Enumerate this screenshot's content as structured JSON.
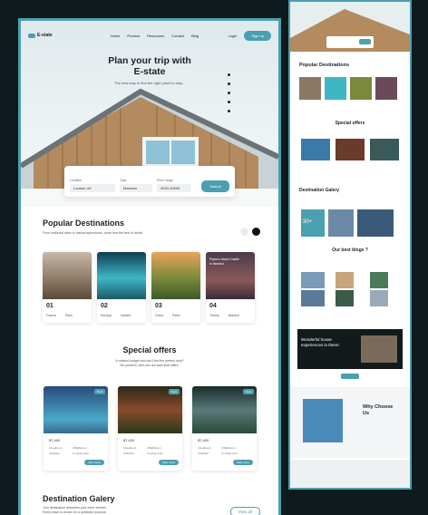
{
  "nav": {
    "logo": "E-state",
    "links": [
      "Home",
      "Product",
      "Resources",
      "Contact",
      "Blog"
    ],
    "login": "Login",
    "signup": "Sign up"
  },
  "hero": {
    "title_line1": "Plan your trip with",
    "title_line2": "E-state",
    "subtitle": "The best way to find the right place to stay..."
  },
  "search": {
    "fields": [
      {
        "label": "Location",
        "value": "London UK"
      },
      {
        "label": "Type",
        "value": "Mansion"
      },
      {
        "label": "Price range",
        "value": "3000-40005"
      }
    ],
    "button": "Search"
  },
  "popular": {
    "title": "Popular Destinations",
    "subtitle": "From historical cities to natural splendours, come see the best of world!",
    "cards": [
      {
        "num": "01",
        "a": "France",
        "b": "Paris"
      },
      {
        "num": "02",
        "a": "Norway",
        "b": "Iceland"
      },
      {
        "num": "03",
        "a": "China",
        "b": "Pekin"
      },
      {
        "num": "04",
        "a": "Turkey",
        "b": "Istanbul",
        "overlay": "Payson Island Castle in Istanbul"
      }
    ]
  },
  "offers": {
    "title": "Special offers",
    "subtitle_line1": "A relaxed budget and can't find the perfect deal?",
    "subtitle_line2": "No problem, here are our best deal offers.",
    "cards": [
      {
        "price": "$7,400",
        "badge": "New",
        "features": [
          "4 bedroom",
          "4 Bathroom",
          "4 kitchen",
          "1 Living room"
        ],
        "button": "View more"
      },
      {
        "price": "$7,400",
        "badge": "New",
        "features": [
          "4 bedroom",
          "4 Bathroom",
          "4 kitchen",
          "1 Living room"
        ],
        "button": "View more"
      },
      {
        "price": "$7,400",
        "badge": "New",
        "features": [
          "4 bedroom",
          "4 Bathroom",
          "4 kitchen",
          "1 Living room"
        ],
        "button": "View more"
      }
    ]
  },
  "gallery": {
    "title": "Destination Galery",
    "sub_line1": "Your destination describes your inner desires.",
    "sub_line2": "Every place is known for a particular purpose.",
    "view_all": "View all"
  },
  "right": {
    "popular": "Popular Destinations",
    "offers": "Special offers",
    "gallery": "Destination Galery",
    "blogs": "Our best blogs ?",
    "promo": "Wonderful house experiences in there!",
    "why": "Why Choose Us",
    "gallery_count": "30+"
  }
}
